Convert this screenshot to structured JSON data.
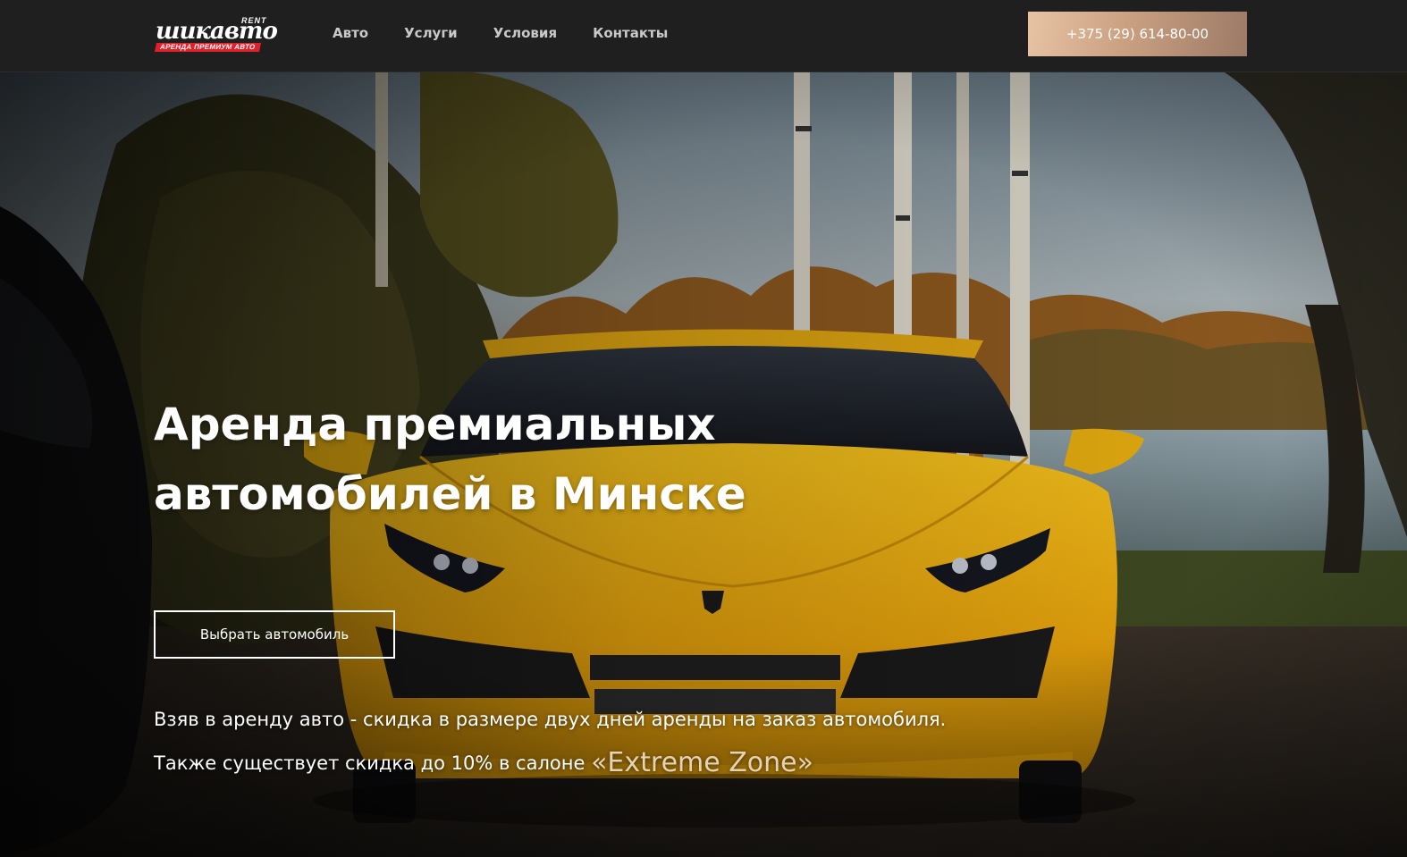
{
  "header": {
    "logo": {
      "script": "шикавто",
      "rent": "RENT",
      "tagline": "АРЕНДА ПРЕМИУМ АВТО"
    },
    "nav": [
      {
        "label": "Авто"
      },
      {
        "label": "Услуги"
      },
      {
        "label": "Условия"
      },
      {
        "label": "Контакты"
      }
    ],
    "phone": "+375 (29) 614-80-00"
  },
  "hero": {
    "title_line1": "Аренда премиальных",
    "title_line2": "автомобилей в Минске",
    "cta_label": "Выбрать автомобиль",
    "promo_line1": "Взяв в аренду авто - скидка в размере двух дней аренды на заказ автомобиля.",
    "promo_line2_prefix": "Также существует скидка до 10% в салоне ",
    "promo_line2_highlight": "«Extreme Zone»"
  },
  "colors": {
    "header_bg": "#1f1f1f",
    "accent_gold": "#caa081",
    "logo_red": "#e3202a",
    "car_yellow": "#f2b10f"
  }
}
